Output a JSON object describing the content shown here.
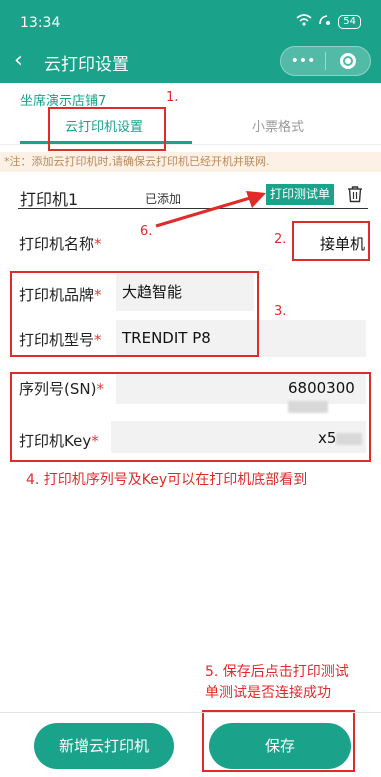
{
  "status_bar": {
    "time": "13:34",
    "battery": "54"
  },
  "nav": {
    "title": "云打印设置",
    "capsule_more": "•••"
  },
  "store_name": "坐席演示店铺7",
  "tabs": [
    {
      "label": "云打印机设置",
      "active": true
    },
    {
      "label": "小票格式",
      "active": false
    }
  ],
  "notice": "*注：添加云打印机时,请确保云打印机已经开机并联网.",
  "printer": {
    "name": "打印机1",
    "status": "已添加",
    "test_button": "打印测试单",
    "fields": {
      "name_label": "打印机名称",
      "name_value": "接单机",
      "brand_label": "打印机品牌",
      "brand_value": "大趋智能",
      "model_label": "打印机型号",
      "model_value": "TRENDIT P8",
      "sn_label": "序列号(SN)",
      "sn_value": "6800300",
      "key_label": "打印机Key",
      "key_value": "x5"
    },
    "required_mark": "*"
  },
  "annotations": {
    "n1": "1.",
    "n2": "2.",
    "n3": "3.",
    "n4": "4. 打印机序列号及Key可以在打印机底部看到",
    "n5_line1": "5. 保存后点击打印测试",
    "n5_line2": "单测试是否连接成功",
    "n6": "6."
  },
  "buttons": {
    "add": "新增云打印机",
    "save": "保存"
  },
  "colors": {
    "accent": "#1aa38a",
    "annotation": "#e02b2b"
  }
}
